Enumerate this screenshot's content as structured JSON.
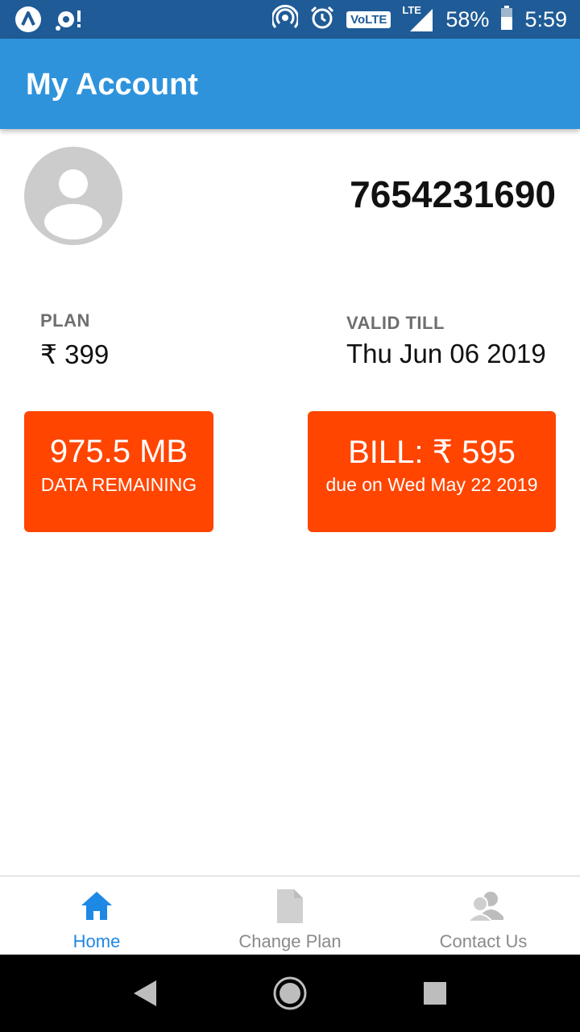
{
  "status_bar": {
    "battery": "58%",
    "time": "5:59",
    "network_badge": "VoLTE",
    "signal_label": "LTE",
    "icons": [
      "app-a-icon",
      "sync-icon",
      "hotspot-icon",
      "alarm-icon",
      "volte-icon",
      "signal-icon",
      "battery-icon"
    ]
  },
  "app_bar": {
    "title": "My Account"
  },
  "profile": {
    "phone_number": "7654231690",
    "avatar_icon": "account-avatar-icon"
  },
  "plan": {
    "label": "PLAN",
    "value": "₹ 399"
  },
  "validity": {
    "label": "VALID TILL",
    "value": "Thu Jun 06 2019"
  },
  "data_card": {
    "amount": "975.5 MB",
    "caption": "DATA REMAINING"
  },
  "bill_card": {
    "amount": "BILL: ₹ 595",
    "caption": "due on Wed May 22 2019"
  },
  "bottom_nav": {
    "items": [
      {
        "label": "Home",
        "icon": "home-icon",
        "active": true
      },
      {
        "label": "Change Plan",
        "icon": "document-icon",
        "active": false
      },
      {
        "label": "Contact Us",
        "icon": "contact-icon",
        "active": false
      }
    ]
  },
  "colors": {
    "status_bar": "#1f5b96",
    "app_bar": "#2f93dc",
    "card": "#ff4500",
    "nav_active": "#1e88e5",
    "nav_inactive": "#8a8a8a"
  }
}
